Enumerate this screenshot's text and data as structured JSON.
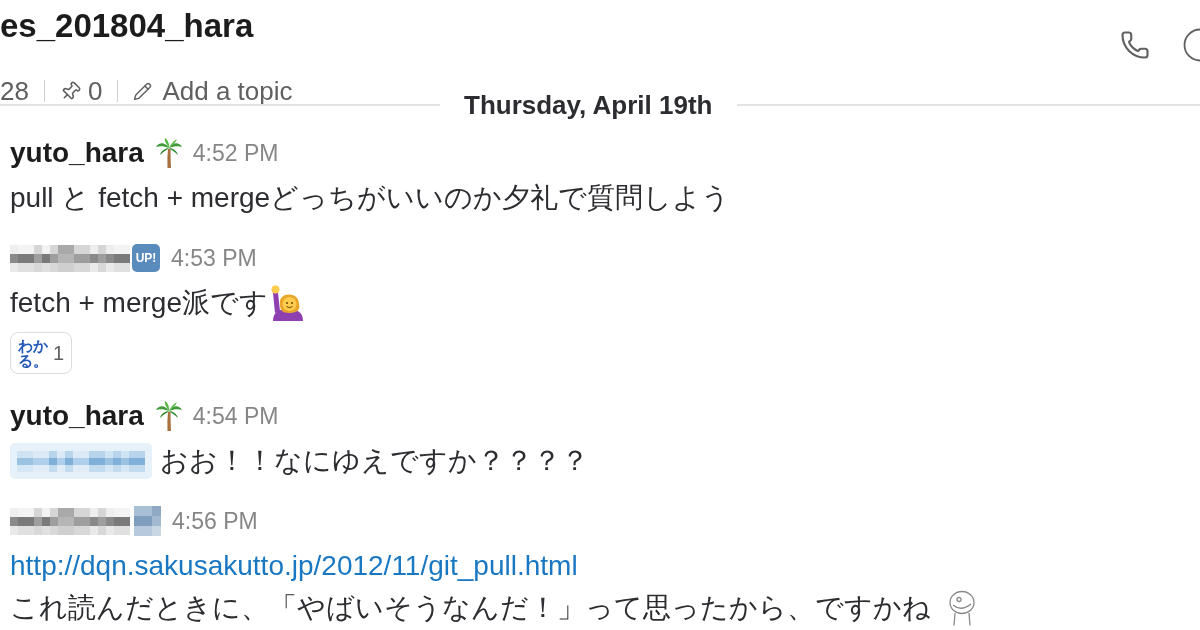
{
  "channel_header": {
    "name": "es_201804_hara",
    "member_count": "28",
    "pinned_count": "0",
    "topic_placeholder": "Add a topic"
  },
  "date_divider": "Thursday, April 19th",
  "messages": [
    {
      "author": {
        "kind": "name",
        "text": "yuto_hara"
      },
      "status_emoji": {
        "kind": "palm"
      },
      "time": "4:52 PM",
      "lines": [
        {
          "parts": [
            {
              "kind": "text",
              "text": "pull と fetch + mergeどっちがいいのか夕礼で質問しよう"
            }
          ]
        }
      ]
    },
    {
      "author": {
        "kind": "pixelated"
      },
      "status_emoji": {
        "kind": "badge",
        "text": "UP!"
      },
      "time": "4:53 PM",
      "lines": [
        {
          "parts": [
            {
              "kind": "text",
              "text": "fetch + merge派です"
            },
            {
              "kind": "raising_hand"
            }
          ]
        }
      ],
      "reactions": [
        {
          "emoji_text": "わかる。",
          "count": "1"
        }
      ]
    },
    {
      "author": {
        "kind": "name",
        "text": "yuto_hara"
      },
      "status_emoji": {
        "kind": "palm"
      },
      "time": "4:54 PM",
      "lines": [
        {
          "parts": [
            {
              "kind": "mention"
            },
            {
              "kind": "text",
              "text": "おお！！なにゆえですか？？？？"
            }
          ]
        }
      ]
    },
    {
      "author": {
        "kind": "pixelated"
      },
      "status_emoji": {
        "kind": "pixelated"
      },
      "time": "4:56 PM",
      "lines": [
        {
          "parts": [
            {
              "kind": "link",
              "text": "http://dqn.sakusakutto.jp/2012/11/git_pull.html"
            }
          ]
        },
        {
          "parts": [
            {
              "kind": "text",
              "text": "これ読んだときに、「やばいそうなんだ！」って思ったから、ですかね"
            },
            {
              "kind": "doodle_face"
            }
          ]
        }
      ]
    }
  ]
}
